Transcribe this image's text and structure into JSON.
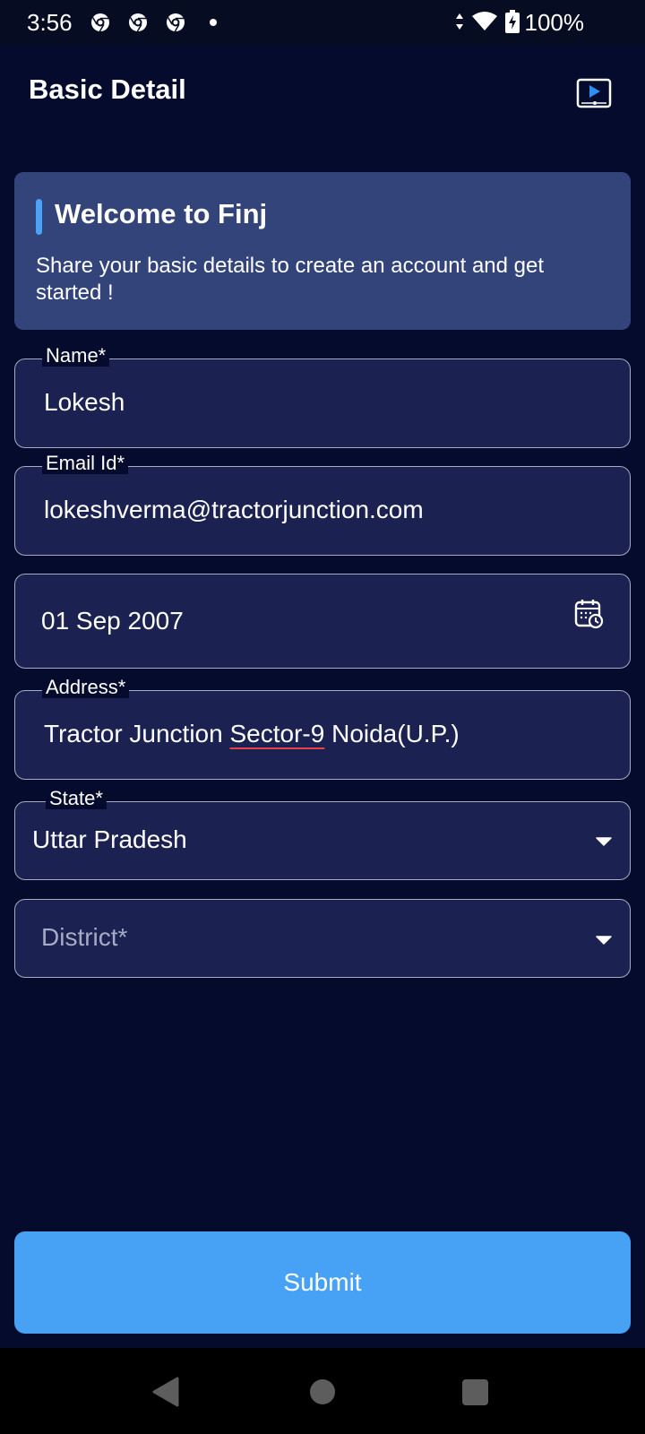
{
  "status_bar": {
    "time": "3:56",
    "battery": "100%"
  },
  "header": {
    "title": "Basic Detail"
  },
  "welcome": {
    "title": "Welcome to Finj",
    "subtitle": "Share your basic details to create an account and get started !"
  },
  "form": {
    "name": {
      "label": "Name*",
      "value": "Lokesh"
    },
    "email": {
      "label": "Email Id*",
      "value": "lokeshverma@tractorjunction.com"
    },
    "dob": {
      "value": "01 Sep 2007"
    },
    "address": {
      "label": "Address*",
      "value_part1": "Tractor Junction ",
      "value_part2": "Sector-9",
      "value_part3": " Noida(U.P.)"
    },
    "state": {
      "label": "State*",
      "value": "Uttar Pradesh"
    },
    "district": {
      "placeholder": "District*"
    }
  },
  "submit_label": "Submit",
  "colors": {
    "background": "#040b2c",
    "card": "#33447a",
    "field": "#1b2150",
    "accent": "#49a3f6",
    "button": "#47a2f5"
  },
  "icons": [
    "chrome-icon",
    "chrome-icon",
    "chrome-icon",
    "data-arrows-icon",
    "wifi-icon",
    "battery-charging-icon",
    "video-tutorial-icon",
    "calendar-clock-icon",
    "chevron-down-icon",
    "nav-back-icon",
    "nav-home-icon",
    "nav-recents-icon"
  ]
}
